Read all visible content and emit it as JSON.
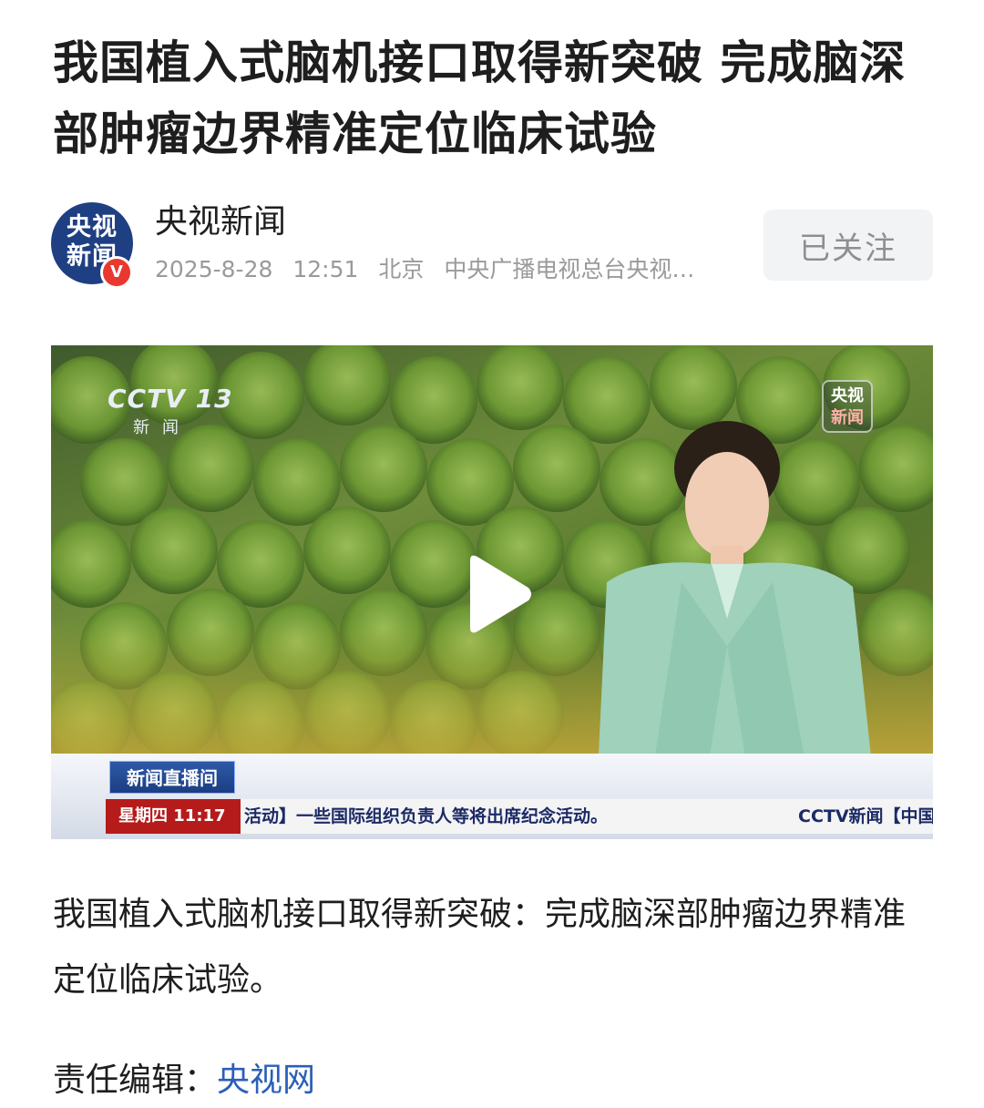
{
  "article": {
    "title": "我国植入式脑机接口取得新突破 完成脑深部肿瘤边界精准定位临床试验",
    "body": "我国植入式脑机接口取得新突破：完成脑深部肿瘤边界精准定位临床试验。",
    "editor_label": "责任编辑：",
    "editor_name": "央视网"
  },
  "author": {
    "avatar_text": "央视\n新闻",
    "verified_mark": "V",
    "name": "央视新闻",
    "date": "2025-8-28",
    "time": "12:51",
    "location": "北京",
    "source": "中央广播电视总台央视…",
    "follow_label": "已关注"
  },
  "video": {
    "channel_logo": "CCTV 13",
    "channel_sub": "新闻",
    "corner_logo_top": "央视",
    "corner_logo_bottom": "新闻",
    "program_tag": "新闻直播间",
    "ticker_day": "星期四 11:17",
    "ticker_text": "活动】一些国际组织负责人等将出席纪念活动。",
    "ticker_logo": "CCTV新闻【中国人"
  },
  "colors": {
    "accent_link": "#2b5fb8",
    "verified_red": "#e8382f",
    "follow_bg": "#f2f3f5",
    "meta_gray": "#9a9a9a"
  },
  "icons": [
    "play-icon",
    "verified-icon"
  ]
}
